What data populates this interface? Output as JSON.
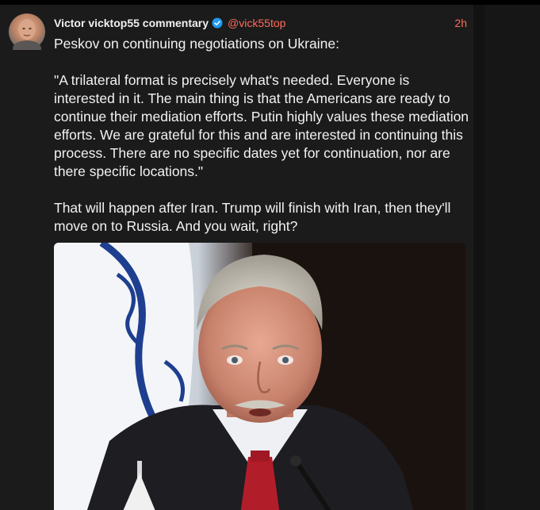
{
  "post": {
    "author": "Victor vicktop55 commentary",
    "handle": "@vick55top",
    "time": "2h",
    "paragraphs": [
      "Peskov on continuing negotiations on Ukraine:",
      "\"A trilateral format is precisely what's needed. Everyone is interested in it. The main thing is that the Americans are ready to continue their mediation efforts. Putin highly values these mediation efforts. We are grateful for this and are interested in continuing this process. There are no specific dates yet for continuation, nor are there specific locations.\"",
      "That will happen after Iran. Trump will finish with Iran, then they'll move on to Russia. And you wait, right?"
    ],
    "avatar_icon": "user-avatar",
    "verified_icon": "verified-badge-icon",
    "photo_subject": "photo"
  },
  "colors": {
    "accent": "#ff6b5a",
    "verified": "#1d9bf0",
    "card_bg": "#1b1b1b",
    "text": "#f2f2f2"
  }
}
